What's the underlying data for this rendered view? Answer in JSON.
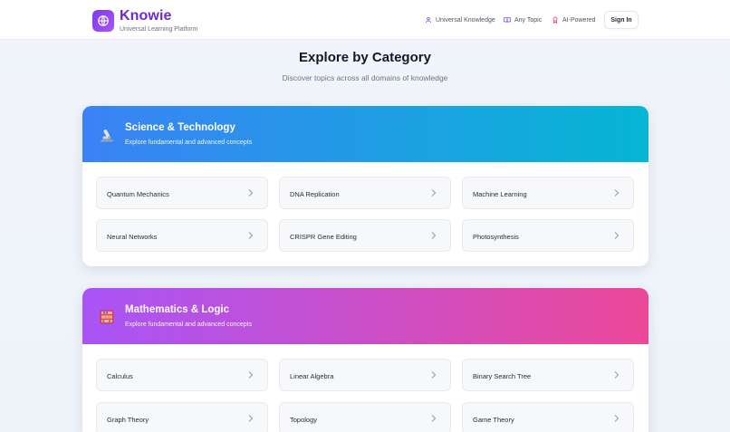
{
  "header": {
    "brand_name": "Knowie",
    "brand_sub": "Universal Learning Platform",
    "nav": [
      {
        "label": "Universal Knowledge",
        "icon": "user-icon"
      },
      {
        "label": "Any Topic",
        "icon": "book-icon"
      },
      {
        "label": "AI-Powered",
        "icon": "award-icon"
      }
    ],
    "signin_label": "Sign In"
  },
  "page": {
    "title": "Explore by Category",
    "subtitle": "Discover topics across all domains of knowledge"
  },
  "categories": [
    {
      "title": "Science & Technology",
      "description": "Explore fundamental and advanced concepts",
      "icon": "microscope-icon",
      "gradient_start": "#3b82f6",
      "gradient_end": "#06b6d4",
      "topics": [
        "Quantum Mechanics",
        "DNA Replication",
        "Machine Learning",
        "Neural Networks",
        "CRISPR Gene Editing",
        "Photosynthesis"
      ]
    },
    {
      "title": "Mathematics & Logic",
      "description": "Explore fundamental and advanced concepts",
      "icon": "abacus-icon",
      "gradient_start": "#a855f7",
      "gradient_end": "#ec4899",
      "topics": [
        "Calculus",
        "Linear Algebra",
        "Binary Search Tree",
        "Graph Theory",
        "Topology",
        "Game Theory"
      ]
    }
  ]
}
